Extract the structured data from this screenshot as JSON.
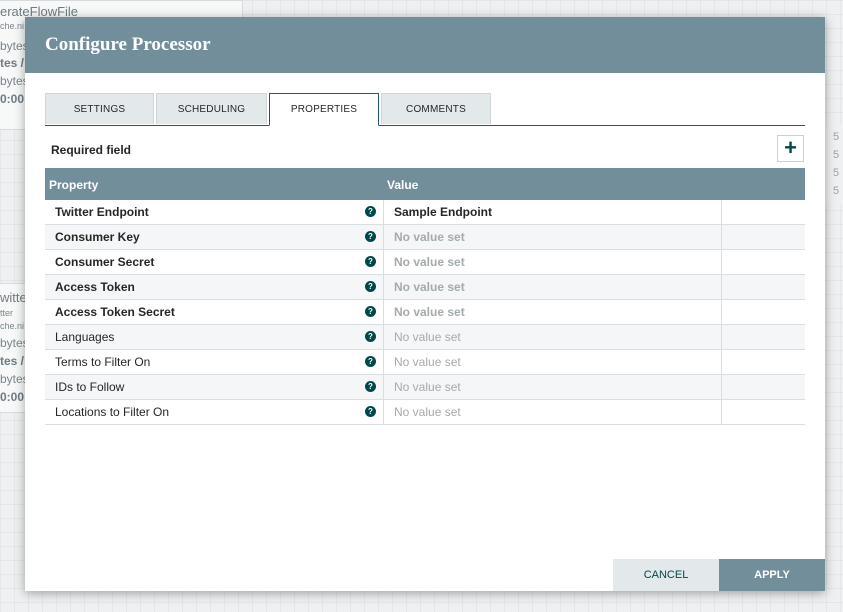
{
  "background": {
    "card1": {
      "title": "erateFlowFile",
      "sub": "che.ni",
      "l3": "bytes",
      "l4": "tes /",
      "l5": "bytes",
      "l6": "0:00:"
    },
    "card2": {
      "title": "witte",
      "sub": "tter",
      "l3": "che.ni",
      "l4": "bytes",
      "l5": "tes /",
      "l6": "bytes",
      "l7": "0:00:"
    },
    "right_numbers": [
      "5",
      "5",
      "5",
      "5"
    ]
  },
  "dialog": {
    "title": "Configure Processor",
    "tabs": [
      {
        "label": "SETTINGS"
      },
      {
        "label": "SCHEDULING"
      },
      {
        "label": "PROPERTIES"
      },
      {
        "label": "COMMENTS"
      }
    ],
    "active_tab": "PROPERTIES",
    "required_label": "Required field",
    "add_icon": "plus-icon",
    "add_glyph": "+",
    "help_glyph": "?",
    "columns": {
      "property": "Property",
      "value": "Value"
    },
    "rows": [
      {
        "name": "Twitter Endpoint",
        "value": "Sample Endpoint"
      },
      {
        "name": "Consumer Key",
        "value": "No value set"
      },
      {
        "name": "Consumer Secret",
        "value": "No value set"
      },
      {
        "name": "Access Token",
        "value": "No value set"
      },
      {
        "name": "Access Token Secret",
        "value": "No value set"
      },
      {
        "name": "Languages",
        "value": "No value set"
      },
      {
        "name": "Terms to Filter On",
        "value": "No value set"
      },
      {
        "name": "IDs to Follow",
        "value": "No value set"
      },
      {
        "name": "Locations to Filter On",
        "value": "No value set"
      }
    ],
    "cancel_label": "CANCEL",
    "apply_label": "APPLY"
  },
  "colors": {
    "header": "#728e9b",
    "accent": "#004849",
    "tab_bg": "#e3e8eb"
  }
}
